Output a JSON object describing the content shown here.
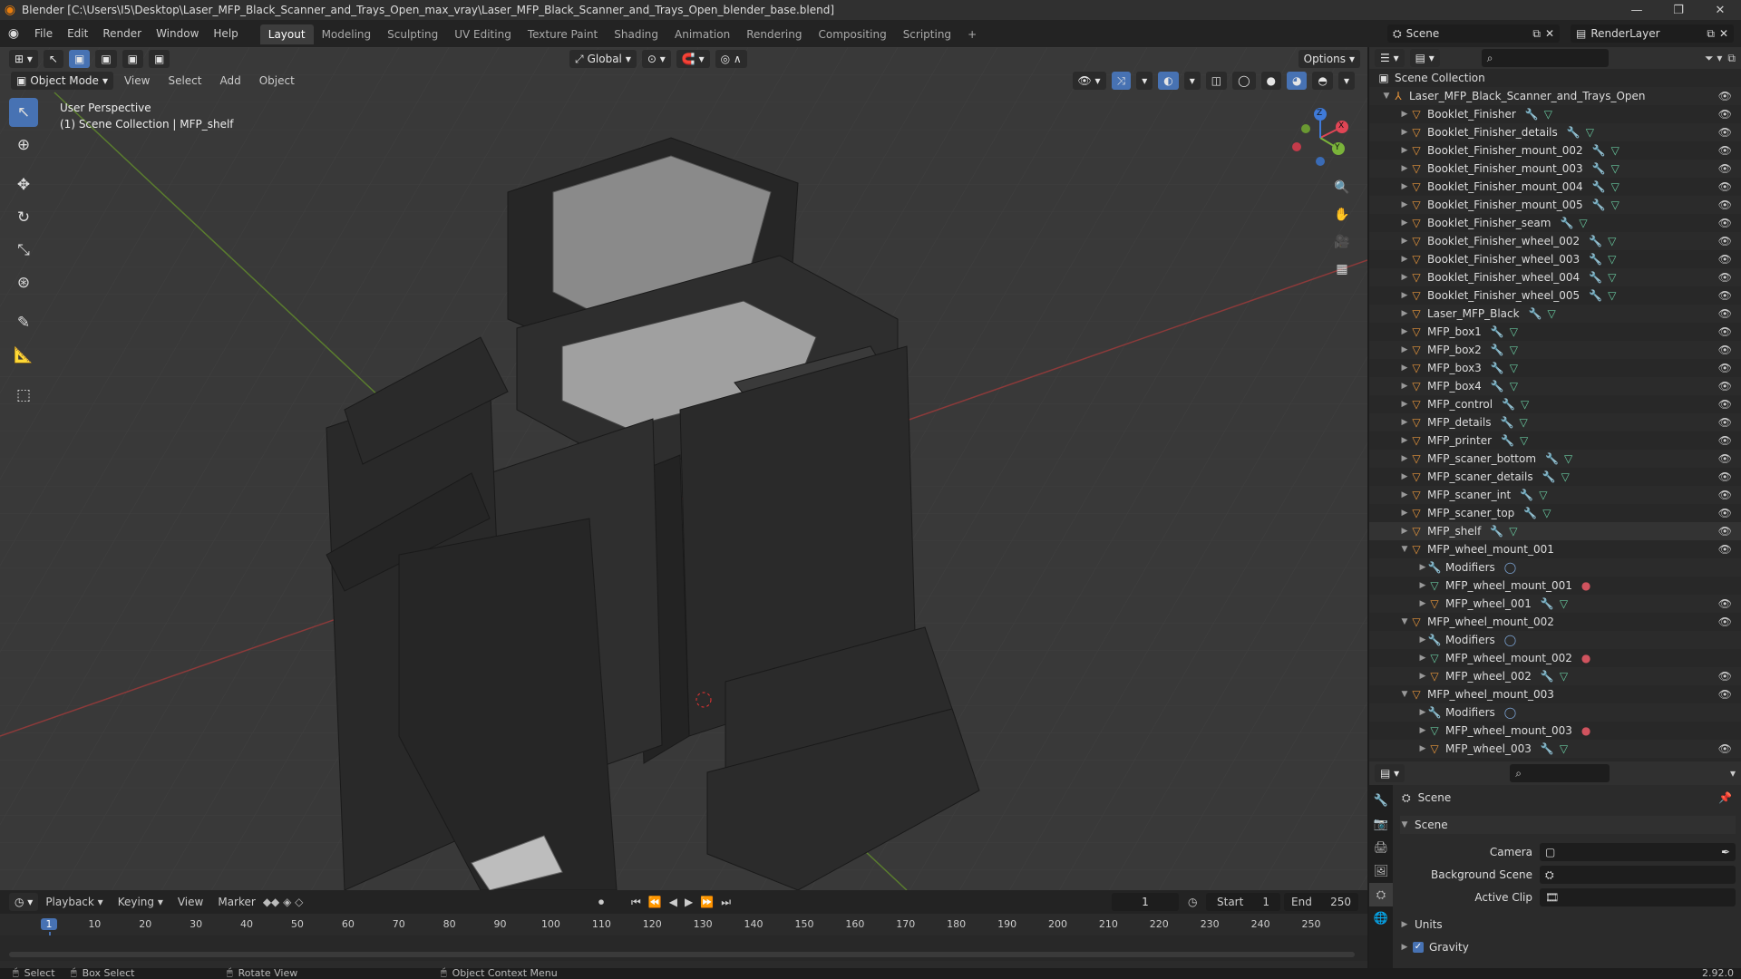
{
  "window": {
    "title": "Blender [C:\\Users\\I5\\Desktop\\Laser_MFP_Black_Scanner_and_Trays_Open_max_vray\\Laser_MFP_Black_Scanner_and_Trays_Open_blender_base.blend]",
    "minimize": "—",
    "maximize": "❐",
    "close": "✕"
  },
  "menu": [
    "File",
    "Edit",
    "Render",
    "Window",
    "Help"
  ],
  "workspaces": [
    "Layout",
    "Modeling",
    "Sculpting",
    "UV Editing",
    "Texture Paint",
    "Shading",
    "Animation",
    "Rendering",
    "Compositing",
    "Scripting"
  ],
  "active_workspace": "Layout",
  "scene_field": "Scene",
  "renderlayer_field": "RenderLayer",
  "viewport": {
    "mode": "Object Mode",
    "menus": [
      "View",
      "Select",
      "Add",
      "Object"
    ],
    "orientation": "Global",
    "options": "Options",
    "overlay_line1": "User Perspective",
    "overlay_line2": "(1) Scene Collection | MFP_shelf",
    "gizmo": {
      "x": "X",
      "y": "Y",
      "z": "Z"
    }
  },
  "outliner": {
    "search_placeholder": "",
    "root": "Scene Collection",
    "collection": "Laser_MFP_Black_Scanner_and_Trays_Open",
    "items": [
      {
        "label": "Booklet_Finisher",
        "kind": "object"
      },
      {
        "label": "Booklet_Finisher_details",
        "kind": "object"
      },
      {
        "label": "Booklet_Finisher_mount_002",
        "kind": "object"
      },
      {
        "label": "Booklet_Finisher_mount_003",
        "kind": "object"
      },
      {
        "label": "Booklet_Finisher_mount_004",
        "kind": "object"
      },
      {
        "label": "Booklet_Finisher_mount_005",
        "kind": "object"
      },
      {
        "label": "Booklet_Finisher_seam",
        "kind": "object"
      },
      {
        "label": "Booklet_Finisher_wheel_002",
        "kind": "object"
      },
      {
        "label": "Booklet_Finisher_wheel_003",
        "kind": "object"
      },
      {
        "label": "Booklet_Finisher_wheel_004",
        "kind": "object"
      },
      {
        "label": "Booklet_Finisher_wheel_005",
        "kind": "object"
      },
      {
        "label": "Laser_MFP_Black",
        "kind": "object"
      },
      {
        "label": "MFP_box1",
        "kind": "object"
      },
      {
        "label": "MFP_box2",
        "kind": "object"
      },
      {
        "label": "MFP_box3",
        "kind": "object"
      },
      {
        "label": "MFP_box4",
        "kind": "object"
      },
      {
        "label": "MFP_control",
        "kind": "object"
      },
      {
        "label": "MFP_details",
        "kind": "object"
      },
      {
        "label": "MFP_printer",
        "kind": "object"
      },
      {
        "label": "MFP_scaner_bottom",
        "kind": "object"
      },
      {
        "label": "MFP_scaner_details",
        "kind": "object"
      },
      {
        "label": "MFP_scaner_int",
        "kind": "object"
      },
      {
        "label": "MFP_scaner_top",
        "kind": "object"
      },
      {
        "label": "MFP_shelf",
        "kind": "object"
      },
      {
        "label": "MFP_wheel_mount_001",
        "kind": "expanded"
      },
      {
        "label": "Modifiers",
        "kind": "modifiers"
      },
      {
        "label": "MFP_wheel_mount_001",
        "kind": "mesh"
      },
      {
        "label": "MFP_wheel_001",
        "kind": "child"
      },
      {
        "label": "MFP_wheel_mount_002",
        "kind": "expanded"
      },
      {
        "label": "Modifiers",
        "kind": "modifiers"
      },
      {
        "label": "MFP_wheel_mount_002",
        "kind": "mesh"
      },
      {
        "label": "MFP_wheel_002",
        "kind": "child"
      },
      {
        "label": "MFP_wheel_mount_003",
        "kind": "expanded"
      },
      {
        "label": "Modifiers",
        "kind": "modifiers"
      },
      {
        "label": "MFP_wheel_mount_003",
        "kind": "mesh"
      },
      {
        "label": "MFP_wheel_003",
        "kind": "child"
      }
    ]
  },
  "properties": {
    "header": "Scene",
    "panel": "Scene",
    "camera_label": "Camera",
    "bg_label": "Background Scene",
    "clip_label": "Active Clip",
    "units": "Units",
    "gravity": "Gravity"
  },
  "timeline": {
    "menus": [
      "Playback",
      "Keying",
      "View",
      "Marker"
    ],
    "current_frame": "1",
    "start_label": "Start",
    "start": "1",
    "end_label": "End",
    "end": "250",
    "ticks": [
      "1",
      "10",
      "20",
      "30",
      "40",
      "50",
      "60",
      "70",
      "80",
      "90",
      "100",
      "110",
      "120",
      "130",
      "140",
      "150",
      "160",
      "170",
      "180",
      "190",
      "200",
      "210",
      "220",
      "230",
      "240",
      "250"
    ]
  },
  "status": {
    "select": "Select",
    "box_select": "Box Select",
    "rotate": "Rotate View",
    "context": "Object Context Menu",
    "version": "2.92.0"
  }
}
